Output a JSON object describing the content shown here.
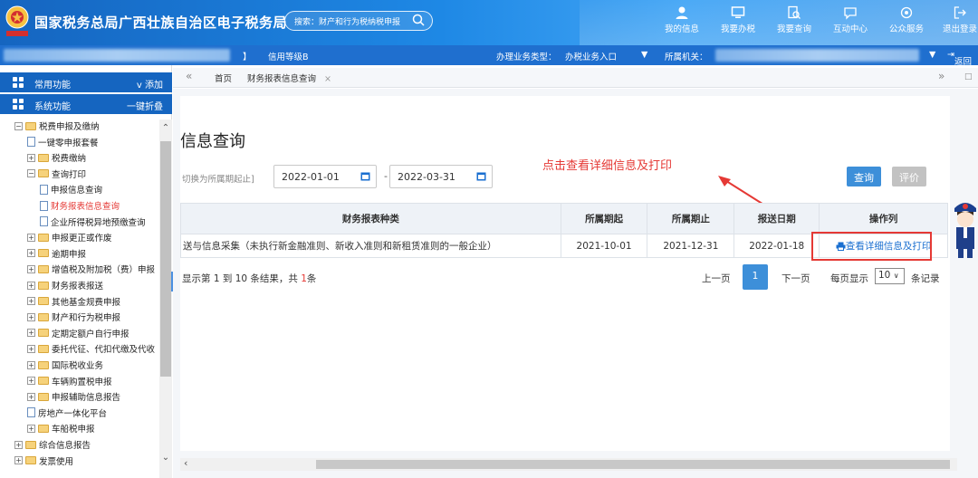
{
  "header": {
    "title": "国家税务总局广西壮族自治区电子税务局",
    "search_placeholder": "搜索：财产和行为税纳税申报",
    "nav": [
      {
        "label": "我的信息",
        "icon": "user-icon"
      },
      {
        "label": "我要办税",
        "icon": "monitor-icon"
      },
      {
        "label": "我要查询",
        "icon": "search-doc-icon"
      },
      {
        "label": "互动中心",
        "icon": "chat-icon"
      },
      {
        "label": "公众服务",
        "icon": "service-icon"
      },
      {
        "label": "退出登录",
        "icon": "logout-icon"
      }
    ]
  },
  "subbar": {
    "credit_prefix": "】",
    "credit_label": "信用等级B",
    "biz_type_label": "办理业务类型：",
    "biz_type_value": "办税业务入口",
    "org_label": "所属机关：",
    "return_label": "返回"
  },
  "sidebar": {
    "common_label": "常用功能",
    "common_action": "v 添加",
    "system_label": "系统功能",
    "system_action": "一键折叠",
    "tree": [
      {
        "label": "税费申报及缴纳",
        "type": "folder",
        "exp": "−"
      },
      {
        "label": "一键零申报套餐",
        "type": "doc"
      },
      {
        "label": "税费缴纳",
        "type": "folder",
        "exp": "+"
      },
      {
        "label": "查询打印",
        "type": "folder",
        "exp": "−"
      },
      {
        "label": "申报信息查询",
        "type": "doc"
      },
      {
        "label": "财务报表信息查询",
        "type": "doc",
        "active": true
      },
      {
        "label": "企业所得税异地预缴查询",
        "type": "doc"
      },
      {
        "label": "申报更正或作废",
        "type": "folder",
        "exp": "+"
      },
      {
        "label": "逾期申报",
        "type": "folder",
        "exp": "+"
      },
      {
        "label": "增值税及附加税（费）申报",
        "type": "folder",
        "exp": "+"
      },
      {
        "label": "财务报表报送",
        "type": "folder",
        "exp": "+"
      },
      {
        "label": "其他基金规费申报",
        "type": "folder",
        "exp": "+"
      },
      {
        "label": "财产和行为税申报",
        "type": "folder",
        "exp": "+"
      },
      {
        "label": "定期定额户自行申报",
        "type": "folder",
        "exp": "+"
      },
      {
        "label": "委托代征、代扣代缴及代收",
        "type": "folder",
        "exp": "+"
      },
      {
        "label": "国际税收业务",
        "type": "folder",
        "exp": "+"
      },
      {
        "label": "车辆购置税申报",
        "type": "folder",
        "exp": "+"
      },
      {
        "label": "申报辅助信息报告",
        "type": "folder",
        "exp": "+"
      },
      {
        "label": "房地产一体化平台",
        "type": "doc"
      },
      {
        "label": "车船税申报",
        "type": "folder",
        "exp": "+"
      },
      {
        "label": "综合信息报告",
        "type": "folder",
        "exp": "+"
      },
      {
        "label": "发票使用",
        "type": "folder",
        "exp": "+"
      }
    ]
  },
  "tabs": {
    "home": "首页",
    "current": "财务报表信息查询",
    "close": "×"
  },
  "main": {
    "title": "信息查询",
    "period_hint": "切换为所属期起止]",
    "date_from": "2022-01-01",
    "date_to": "2022-03-31",
    "dash": "-",
    "query_button": "查询",
    "rate_button": "评价",
    "annotation": "点击查看详细信息及打印",
    "table": {
      "headers": [
        "财务报表种类",
        "所属期起",
        "所属期止",
        "报送日期",
        "操作列"
      ],
      "rows": [
        {
          "type": "送与信息采集（未执行新金融准则、新收入准则和新租赁准则的一般企业）",
          "period_start": "2021-10-01",
          "period_end": "2021-12-31",
          "submit_date": "2022-01-18",
          "action": "查看详细信息及打印"
        }
      ]
    },
    "pager": {
      "info_prefix": "显示第 1 到 10 条结果，共 ",
      "total": "1",
      "info_suffix": "条",
      "prev": "上一页",
      "current": "1",
      "next": "下一页",
      "per_page_label": "每页显示",
      "per_page_value": "10",
      "unit": "条记录"
    }
  },
  "colors": {
    "brand_blue": "#1565c0",
    "accent_blue": "#3d8fd9",
    "highlight_red": "#e53935"
  }
}
